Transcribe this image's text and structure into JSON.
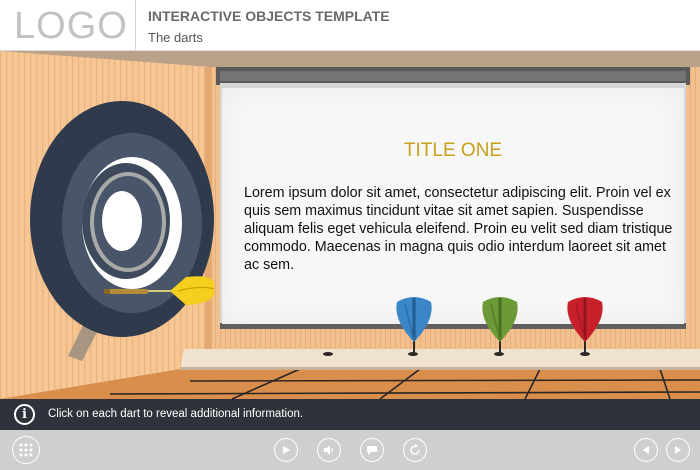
{
  "header": {
    "logo": "LOGO",
    "course_title": "INTERACTIVE OBJECTS TEMPLATE",
    "slide_title": "The darts"
  },
  "board": {
    "title": "TITLE ONE",
    "body": "Lorem ipsum dolor sit amet, consectetur adipiscing elit. Proin vel ex quis sem maximus tincidunt vitae sit amet sapien. Suspendisse aliquam felis eget vehicula eleifend. Proin eu velit sed diam tristique commodo. Maecenas in magna quis odio interdum laoreet sit amet ac sem."
  },
  "darts": [
    {
      "color": "blue",
      "hex": "#3a86c6"
    },
    {
      "color": "green",
      "hex": "#6c9a36"
    },
    {
      "color": "red",
      "hex": "#c8202b"
    }
  ],
  "instruction": {
    "icon": "info-icon",
    "text": "Click on each dart to reveal additional information."
  },
  "navigation": {
    "buttons": [
      "menu-grid-icon",
      "play-icon",
      "volume-icon",
      "captions-icon",
      "replay-icon",
      "previous-icon",
      "next-icon"
    ]
  },
  "colors": {
    "wall": "#f5c492",
    "floor": "#d98e4c",
    "title_accent": "#c6a21a",
    "instruction_bar": "#2f323a",
    "navbar": "#cfcfcf"
  }
}
